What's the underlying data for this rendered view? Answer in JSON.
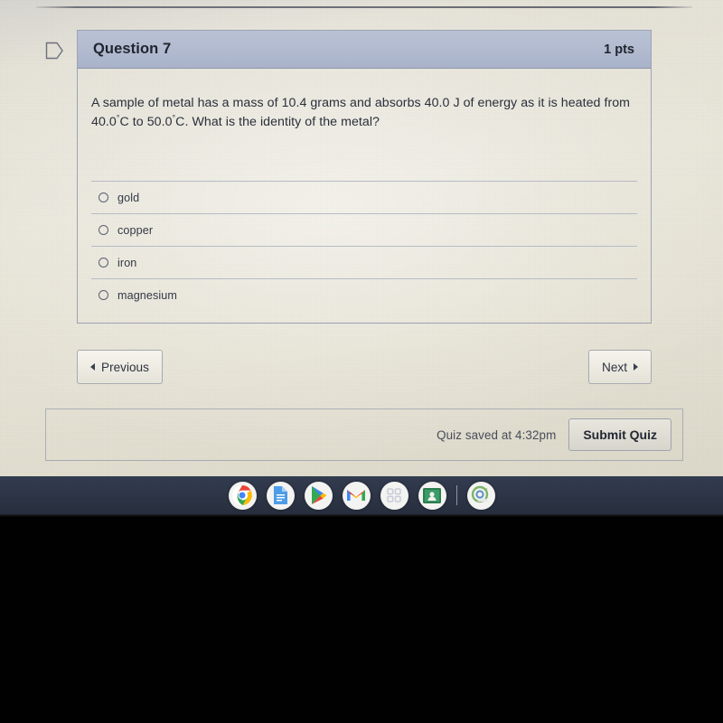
{
  "question": {
    "flag_icon": "flag-outline-icon",
    "title": "Question 7",
    "points": "1 pts",
    "text_line1": "A sample of metal has a mass of 10.4 grams and absorbs 40.0 J of energy as it is heated from",
    "text_line2_a": "40.0",
    "text_line2_deg": "°",
    "text_line2_b": "C to 50.0",
    "text_line2_c": "C.  What is the identity of the metal?",
    "options": [
      {
        "label": "gold",
        "selected": false
      },
      {
        "label": "copper",
        "selected": false
      },
      {
        "label": "iron",
        "selected": false
      },
      {
        "label": "magnesium",
        "selected": false
      }
    ]
  },
  "navigation": {
    "previous_label": "Previous",
    "next_label": "Next",
    "prev_icon": "triangle-left-icon",
    "next_icon": "triangle-right-icon"
  },
  "footer": {
    "saved_status": "Quiz saved at 4:32pm",
    "submit_label": "Submit Quiz"
  },
  "shelf": {
    "items": [
      {
        "name": "chrome-icon",
        "label": "Google Chrome",
        "active": true
      },
      {
        "name": "google-docs-icon",
        "label": "Google Docs",
        "active": false
      },
      {
        "name": "play-store-icon",
        "label": "Google Play Store",
        "active": false
      },
      {
        "name": "gmail-icon",
        "label": "Gmail",
        "active": false
      },
      {
        "name": "app-launcher-icon",
        "label": "App Launcher",
        "active": false
      },
      {
        "name": "google-classroom-icon",
        "label": "Google Classroom",
        "active": false
      },
      {
        "name": "recovery-sync-icon",
        "label": "Recovery Utility",
        "active": true
      }
    ]
  },
  "colors": {
    "header_blue": "#b1bacf",
    "page_background": "#e8e5d8",
    "shelf_background": "#2c3445",
    "text_dark": "#2a2f3a"
  }
}
